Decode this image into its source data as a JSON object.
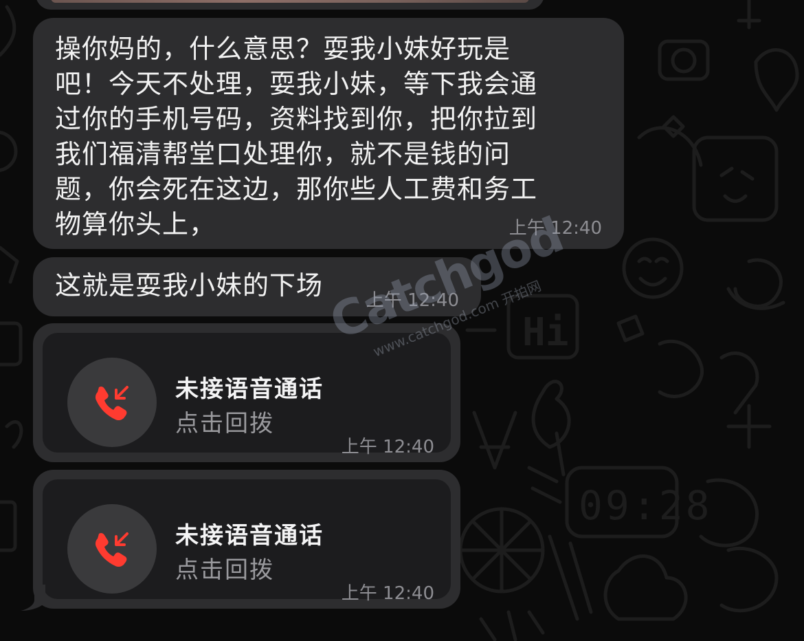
{
  "messages": [
    {
      "text": "操你妈的，什么意思？耍我小妹好玩是吧！今天不处理，耍我小妹，等下我会通过你的手机号码，资料找到你，把你拉到我们福清帮堂口处理你，就不是钱的问题，你会死在这边，那你些人工费和务工物算你头上，",
      "lines": [
        "操你妈的，什么意思？耍我小妹好玩是",
        "吧！今天不处理，耍我小妹，等下我会通",
        "过你的手机号码，资料找到你，把你拉到",
        "我们福清帮堂口处理你，就不是钱的问",
        "题，你会死在这边，那你些人工费和务工",
        "物算你头上，"
      ],
      "time": "上午 12:40"
    },
    {
      "text": "这就是耍我小妹的下场",
      "time": "上午 12:40"
    }
  ],
  "calls": [
    {
      "title": "未接语音通话",
      "subtitle": "点击回拨",
      "time": "上午 12:40",
      "icon": "missed-call-icon"
    },
    {
      "title": "未接语音通话",
      "subtitle": "点击回拨",
      "time": "上午 12:40",
      "icon": "missed-call-icon"
    }
  ],
  "watermark": {
    "logo": "Catchgod",
    "url": "www.catchgod.com 开拍网"
  },
  "colors": {
    "background": "#0b0b0b",
    "bubble": "#2d2d2f",
    "call_inner": "#1c1c1e",
    "missed_call_red": "#ff3b30",
    "timestamp": "#8e8e93"
  },
  "wallpaper": {
    "clock_text": "09:28",
    "hi_text": "Hi",
    "letter_a": "A"
  }
}
